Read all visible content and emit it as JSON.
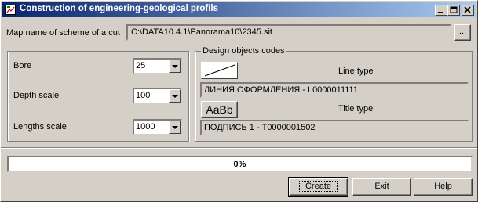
{
  "window": {
    "title": "Construction of engineering-geological profils"
  },
  "map": {
    "label": "Map name of scheme of a cut",
    "value": "C:\\DATA10.4.1\\Panorama10\\2345.sit",
    "browse_label": "..."
  },
  "params": [
    {
      "label": "Bore",
      "value": "25"
    },
    {
      "label": "Depth scale",
      "value": "100"
    },
    {
      "label": "Lengths scale",
      "value": "1000"
    }
  ],
  "design": {
    "group_title": "Design objects codes",
    "line_type_label": "Line type",
    "line_type_value": "ЛИНИЯ ОФОРМЛЕНИЯ - L0000011111",
    "title_type_label": "Title type",
    "title_sample": "AaBb",
    "title_type_value": "ПОДПИСЬ 1 - T0000001502"
  },
  "progress": {
    "value": 0,
    "text": "0%"
  },
  "buttons": {
    "create": "Create",
    "exit": "Exit",
    "help": "Help"
  }
}
